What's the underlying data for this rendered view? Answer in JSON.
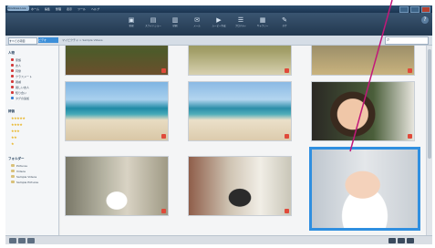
{
  "app": {
    "title": "Windows Live"
  },
  "menu": [
    "ホーム",
    "編集",
    "整理",
    "表示",
    "ツール",
    "ヘルプ"
  ],
  "toolbar": [
    {
      "label": "新規",
      "icon": "new-icon"
    },
    {
      "label": "スライドショー",
      "icon": "slideshow-icon"
    },
    {
      "label": "印刷",
      "icon": "print-icon"
    },
    {
      "label": "メール",
      "icon": "mail-icon"
    },
    {
      "label": "ムービー作成",
      "icon": "movie-icon"
    },
    {
      "label": "プロパティ",
      "icon": "properties-icon"
    },
    {
      "label": "ギャラリー",
      "icon": "gallery-icon"
    },
    {
      "label": "タグ",
      "icon": "tag-icon"
    }
  ],
  "nav": {
    "all_items": "すべての項目",
    "current": "ビデオ",
    "breadcrumb": "マイピクチャ > Sample Videos",
    "search_placeholder": "検索"
  },
  "sidebar": {
    "section_people": "人物",
    "people": [
      {
        "label": "家族",
        "color": "#d33a3a"
      },
      {
        "label": "友人",
        "color": "#d33a3a"
      },
      {
        "label": "同僚",
        "color": "#d33a3a"
      },
      {
        "label": "クラスメート",
        "color": "#d33a3a"
      },
      {
        "label": "親戚",
        "color": "#d33a3a"
      },
      {
        "label": "親しい友人",
        "color": "#d33a3a"
      },
      {
        "label": "知り合い",
        "color": "#d33a3a"
      },
      {
        "label": "タグの追加",
        "color": "#3a7fd3"
      }
    ],
    "section_rating": "評価",
    "ratings": [
      "★★★★★",
      "★★★★",
      "★★★",
      "★★",
      "★"
    ],
    "section_folders": "フォルダー",
    "folders": [
      "Pictures",
      "Videos",
      "Sample Videos",
      "Sample Pictures"
    ]
  }
}
